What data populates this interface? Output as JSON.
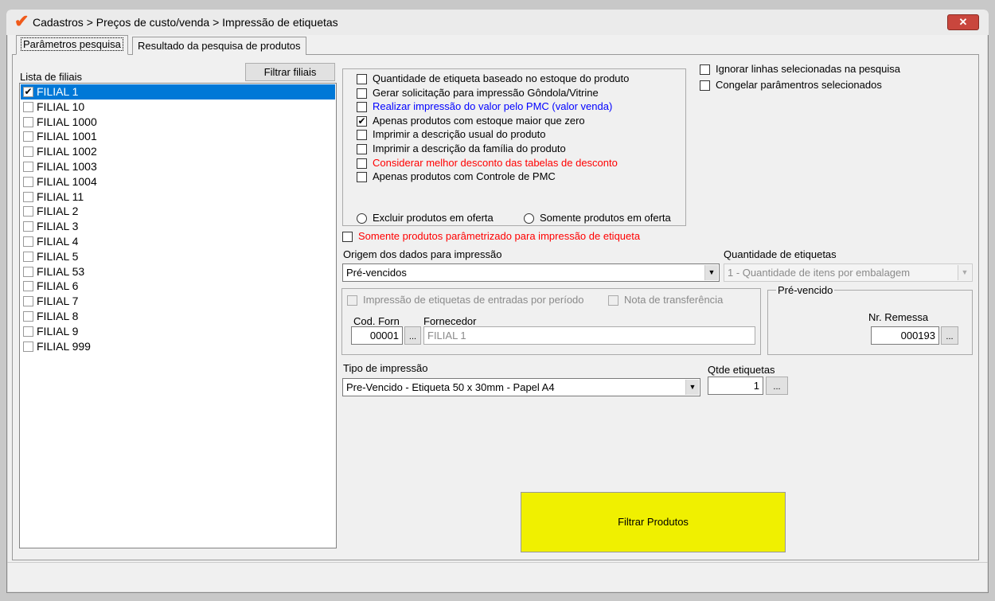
{
  "window": {
    "title": "Cadastros > Preços de custo/venda > Impressão de etiquetas",
    "close": "✕"
  },
  "tabs": [
    "Parâmetros pesquisa",
    "Resultado da pesquisa de produtos"
  ],
  "branches": {
    "label": "Lista de filiais",
    "filter_button": "Filtrar filiais",
    "items": [
      {
        "label": "FILIAL 1",
        "checked": true
      },
      {
        "label": "FILIAL 10"
      },
      {
        "label": "FILIAL 1000"
      },
      {
        "label": "FILIAL 1001"
      },
      {
        "label": "FILIAL 1002"
      },
      {
        "label": "FILIAL 1003"
      },
      {
        "label": "FILIAL 1004"
      },
      {
        "label": "FILIAL 11"
      },
      {
        "label": "FILIAL 2"
      },
      {
        "label": "FILIAL 3"
      },
      {
        "label": "FILIAL 4"
      },
      {
        "label": "FILIAL 5"
      },
      {
        "label": "FILIAL 53"
      },
      {
        "label": "FILIAL 6"
      },
      {
        "label": "FILIAL 7"
      },
      {
        "label": "FILIAL 8"
      },
      {
        "label": "FILIAL 9"
      },
      {
        "label": "FILIAL 999"
      }
    ]
  },
  "options": [
    {
      "label": "Quantidade de etiqueta baseado no estoque do produto",
      "checked": false,
      "color": "#000000"
    },
    {
      "label": "Gerar solicitação para impressão Gôndola/Vitrine",
      "checked": false,
      "color": "#000000"
    },
    {
      "label": "Realizar impressão do valor pelo PMC (valor venda)",
      "checked": false,
      "color": "#0000ff"
    },
    {
      "label": "Apenas produtos com estoque maior que zero",
      "checked": true,
      "color": "#000000"
    },
    {
      "label": "Imprimir a descrição usual do produto",
      "checked": false,
      "color": "#000000"
    },
    {
      "label": "Imprimir a descrição da família do produto",
      "checked": false,
      "color": "#000000"
    },
    {
      "label": "Considerar melhor desconto das tabelas de desconto",
      "checked": false,
      "color": "#ff0000"
    },
    {
      "label": "Apenas produtos com Controle de PMC",
      "checked": false,
      "color": "#000000"
    }
  ],
  "radios": [
    "Excluir produtos em oferta",
    "Somente produtos em oferta"
  ],
  "right_options": [
    "Ignorar linhas selecionadas na pesquisa",
    "Congelar parâmentros selecionados"
  ],
  "only_param": "Somente produtos parâmetrizado para impressão de etiqueta",
  "origin": {
    "label": "Origem dos dados para impressão",
    "value": "Pré-vencidos"
  },
  "qty_type": {
    "label": "Quantidade de  etiquetas",
    "value": "1 - Quantidade de itens por embalagem"
  },
  "entries": {
    "period": "Impressão de etiquetas de entradas por período",
    "transfer": "Nota de transferência",
    "cod_label": "Cod. Forn",
    "cod_value": "00001",
    "supplier_label": "Fornecedor",
    "supplier_value": "FILIAL 1",
    "dots": "..."
  },
  "prevencido": {
    "title": "Pré-vencido",
    "remessa_label": "Nr. Remessa",
    "remessa_value": "000193"
  },
  "print_type": {
    "label": "Tipo de impressão",
    "value": "Pre-Vencido - Etiqueta 50 x 30mm - Papel A4"
  },
  "qtde": {
    "label": "Qtde etiquetas",
    "value": "1"
  },
  "filter_button": "Filtrar Produtos"
}
